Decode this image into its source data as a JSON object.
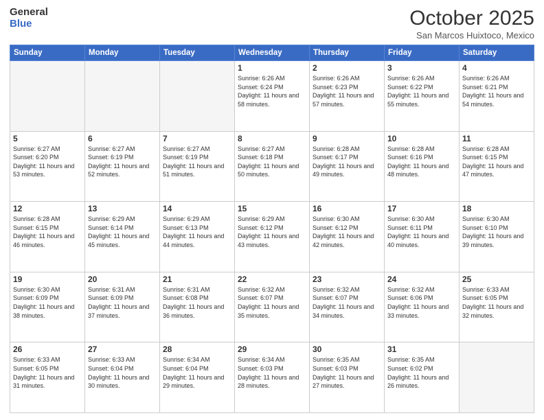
{
  "logo": {
    "general": "General",
    "blue": "Blue"
  },
  "header": {
    "month": "October 2025",
    "location": "San Marcos Huixtoco, Mexico"
  },
  "weekdays": [
    "Sunday",
    "Monday",
    "Tuesday",
    "Wednesday",
    "Thursday",
    "Friday",
    "Saturday"
  ],
  "weeks": [
    [
      {
        "day": "",
        "text": ""
      },
      {
        "day": "",
        "text": ""
      },
      {
        "day": "",
        "text": ""
      },
      {
        "day": "1",
        "text": "Sunrise: 6:26 AM\nSunset: 6:24 PM\nDaylight: 11 hours and 58 minutes."
      },
      {
        "day": "2",
        "text": "Sunrise: 6:26 AM\nSunset: 6:23 PM\nDaylight: 11 hours and 57 minutes."
      },
      {
        "day": "3",
        "text": "Sunrise: 6:26 AM\nSunset: 6:22 PM\nDaylight: 11 hours and 55 minutes."
      },
      {
        "day": "4",
        "text": "Sunrise: 6:26 AM\nSunset: 6:21 PM\nDaylight: 11 hours and 54 minutes."
      }
    ],
    [
      {
        "day": "5",
        "text": "Sunrise: 6:27 AM\nSunset: 6:20 PM\nDaylight: 11 hours and 53 minutes."
      },
      {
        "day": "6",
        "text": "Sunrise: 6:27 AM\nSunset: 6:19 PM\nDaylight: 11 hours and 52 minutes."
      },
      {
        "day": "7",
        "text": "Sunrise: 6:27 AM\nSunset: 6:19 PM\nDaylight: 11 hours and 51 minutes."
      },
      {
        "day": "8",
        "text": "Sunrise: 6:27 AM\nSunset: 6:18 PM\nDaylight: 11 hours and 50 minutes."
      },
      {
        "day": "9",
        "text": "Sunrise: 6:28 AM\nSunset: 6:17 PM\nDaylight: 11 hours and 49 minutes."
      },
      {
        "day": "10",
        "text": "Sunrise: 6:28 AM\nSunset: 6:16 PM\nDaylight: 11 hours and 48 minutes."
      },
      {
        "day": "11",
        "text": "Sunrise: 6:28 AM\nSunset: 6:15 PM\nDaylight: 11 hours and 47 minutes."
      }
    ],
    [
      {
        "day": "12",
        "text": "Sunrise: 6:28 AM\nSunset: 6:15 PM\nDaylight: 11 hours and 46 minutes."
      },
      {
        "day": "13",
        "text": "Sunrise: 6:29 AM\nSunset: 6:14 PM\nDaylight: 11 hours and 45 minutes."
      },
      {
        "day": "14",
        "text": "Sunrise: 6:29 AM\nSunset: 6:13 PM\nDaylight: 11 hours and 44 minutes."
      },
      {
        "day": "15",
        "text": "Sunrise: 6:29 AM\nSunset: 6:12 PM\nDaylight: 11 hours and 43 minutes."
      },
      {
        "day": "16",
        "text": "Sunrise: 6:30 AM\nSunset: 6:12 PM\nDaylight: 11 hours and 42 minutes."
      },
      {
        "day": "17",
        "text": "Sunrise: 6:30 AM\nSunset: 6:11 PM\nDaylight: 11 hours and 40 minutes."
      },
      {
        "day": "18",
        "text": "Sunrise: 6:30 AM\nSunset: 6:10 PM\nDaylight: 11 hours and 39 minutes."
      }
    ],
    [
      {
        "day": "19",
        "text": "Sunrise: 6:30 AM\nSunset: 6:09 PM\nDaylight: 11 hours and 38 minutes."
      },
      {
        "day": "20",
        "text": "Sunrise: 6:31 AM\nSunset: 6:09 PM\nDaylight: 11 hours and 37 minutes."
      },
      {
        "day": "21",
        "text": "Sunrise: 6:31 AM\nSunset: 6:08 PM\nDaylight: 11 hours and 36 minutes."
      },
      {
        "day": "22",
        "text": "Sunrise: 6:32 AM\nSunset: 6:07 PM\nDaylight: 11 hours and 35 minutes."
      },
      {
        "day": "23",
        "text": "Sunrise: 6:32 AM\nSunset: 6:07 PM\nDaylight: 11 hours and 34 minutes."
      },
      {
        "day": "24",
        "text": "Sunrise: 6:32 AM\nSunset: 6:06 PM\nDaylight: 11 hours and 33 minutes."
      },
      {
        "day": "25",
        "text": "Sunrise: 6:33 AM\nSunset: 6:05 PM\nDaylight: 11 hours and 32 minutes."
      }
    ],
    [
      {
        "day": "26",
        "text": "Sunrise: 6:33 AM\nSunset: 6:05 PM\nDaylight: 11 hours and 31 minutes."
      },
      {
        "day": "27",
        "text": "Sunrise: 6:33 AM\nSunset: 6:04 PM\nDaylight: 11 hours and 30 minutes."
      },
      {
        "day": "28",
        "text": "Sunrise: 6:34 AM\nSunset: 6:04 PM\nDaylight: 11 hours and 29 minutes."
      },
      {
        "day": "29",
        "text": "Sunrise: 6:34 AM\nSunset: 6:03 PM\nDaylight: 11 hours and 28 minutes."
      },
      {
        "day": "30",
        "text": "Sunrise: 6:35 AM\nSunset: 6:03 PM\nDaylight: 11 hours and 27 minutes."
      },
      {
        "day": "31",
        "text": "Sunrise: 6:35 AM\nSunset: 6:02 PM\nDaylight: 11 hours and 26 minutes."
      },
      {
        "day": "",
        "text": ""
      }
    ]
  ]
}
